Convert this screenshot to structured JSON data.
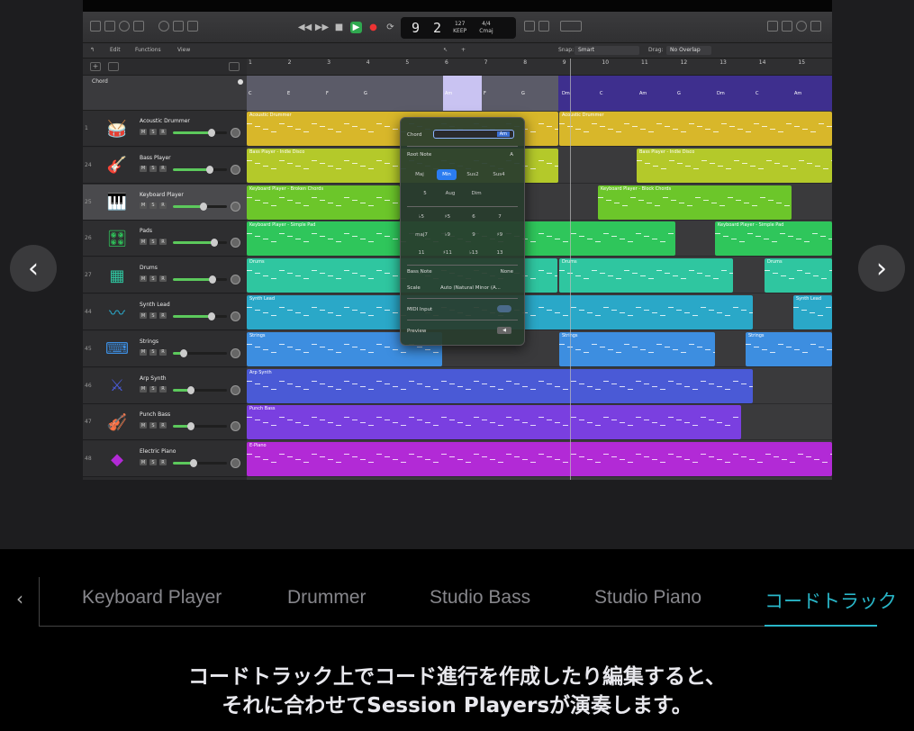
{
  "lcd": {
    "position": "9 2",
    "tempo_value": "127",
    "tempo_label": "KEEP",
    "time_sig": "4/4",
    "key": "Cmaj"
  },
  "edit_bar": {
    "edit": "Edit",
    "functions": "Functions",
    "view": "View",
    "snap_label": "Snap:",
    "snap_value": "Smart",
    "drag_label": "Drag:",
    "drag_value": "No Overlap"
  },
  "chord_track_label": "Chord",
  "ruler_bars": [
    "1",
    "2",
    "3",
    "4",
    "5",
    "6",
    "7",
    "8",
    "9",
    "10",
    "11",
    "12",
    "13",
    "14",
    "15"
  ],
  "chords": [
    "C",
    "E",
    "F",
    "G",
    "Am",
    "F",
    "G",
    "Dm",
    "C",
    "Am",
    "G",
    "Dm",
    "C",
    "Am"
  ],
  "tracks": [
    {
      "num": "1",
      "name": "Acoustic Drummer",
      "icon": "drum-kit-icon",
      "glyph": "🥁",
      "color": "#d8b72a",
      "regions": [
        "Acoustic Drummer",
        "Acoustic Drummer"
      ]
    },
    {
      "num": "24",
      "name": "Bass Player",
      "icon": "guitar-icon",
      "glyph": "🎸",
      "color": "#b4c92a",
      "regions": [
        "Bass Player - Indie Disco",
        "Bass Player - Indie Disco"
      ]
    },
    {
      "num": "25",
      "name": "Keyboard Player",
      "icon": "piano-icon",
      "glyph": "🎹",
      "color": "#6cc62a",
      "regions": [
        "Keyboard Player - Broken Chords",
        "Keyboard Player - Block Chords"
      ]
    },
    {
      "num": "26",
      "name": "Pads",
      "icon": "synth-icon",
      "glyph": "🎛",
      "color": "#2fc65b",
      "regions": [
        "Keyboard Player - Simple Pad",
        "Keyboard Player - Simple Pad"
      ]
    },
    {
      "num": "27",
      "name": "Drums",
      "icon": "drum-machine-icon",
      "glyph": "▦",
      "color": "#2fc6a0",
      "regions": [
        "Drums",
        "Drums",
        "Drums"
      ]
    },
    {
      "num": "44",
      "name": "Synth Lead",
      "icon": "waveform-icon",
      "glyph": "〰",
      "color": "#2aa8c8",
      "regions": [
        "Synth Lead",
        "Synth Lead",
        "Synth Lead"
      ]
    },
    {
      "num": "45",
      "name": "Strings",
      "icon": "keyboard-icon",
      "glyph": "⌨",
      "color": "#3d8ee0",
      "regions": [
        "Strings",
        "Strings",
        "Strings"
      ]
    },
    {
      "num": "46",
      "name": "Arp Synth",
      "icon": "arp-icon",
      "glyph": "⚔",
      "color": "#4a5ad6",
      "regions": [
        "Arp Synth",
        "Arp Synth"
      ]
    },
    {
      "num": "47",
      "name": "Punch Bass",
      "icon": "instruments-icon",
      "glyph": "🎻",
      "color": "#7a3fe0",
      "regions": [
        "Punch Bass",
        "Punch Bass"
      ]
    },
    {
      "num": "48",
      "name": "Electric Piano",
      "icon": "eraser-icon",
      "glyph": "◆",
      "color": "#b22ad6",
      "regions": [
        "E-Piano",
        "E-Piano"
      ]
    }
  ],
  "popover": {
    "chord_label": "Chord",
    "chord_value": "Am",
    "root_label": "Root Note",
    "root_value": "A",
    "qualities": [
      "Maj",
      "Min",
      "Sus2",
      "Sus4",
      "5",
      "Aug",
      "Dim"
    ],
    "extensions": [
      "♭5",
      "♯5",
      "6",
      "7",
      "maj7",
      "♭9",
      "9",
      "♯9",
      "11",
      "♯11",
      "♭13",
      "13"
    ],
    "bass_label": "Bass Note",
    "bass_value": "None",
    "scale_label": "Scale",
    "scale_value": "Auto (Natural Minor (A...",
    "midi_label": "MIDI Input",
    "preview_label": "Preview"
  },
  "nav": {
    "prev": "‹",
    "next": "›"
  },
  "tabs": {
    "back": "‹",
    "items": [
      "Keyboard Player",
      "Drummer",
      "Studio Bass",
      "Studio Piano",
      "コードトラック"
    ],
    "active_index": 4
  },
  "caption": {
    "line1": "コードトラック上でコード進行を作成したり編集すると、",
    "line2": "それに合わせてSession Playersが演奏します。"
  },
  "colors": {
    "accent": "#29b6c8",
    "play": "#2fa84f",
    "selected_button": "#2b7cf0"
  }
}
